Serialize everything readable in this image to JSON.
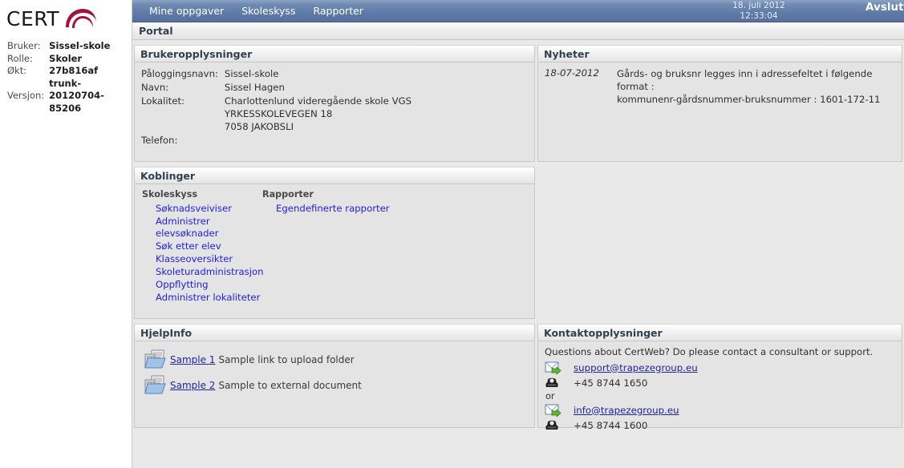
{
  "sidebar": {
    "logo_text": "CERT",
    "logo_mark_color": "#A3123A",
    "fields": [
      {
        "label": "Bruker:",
        "value": "Sissel-skole"
      },
      {
        "label": "Rolle:",
        "value": "Skoler"
      },
      {
        "label": "Økt:",
        "value": "27b816af"
      },
      {
        "label": "Versjon:",
        "value": "trunk-20120704-85206"
      }
    ],
    "version_lines": [
      "trunk-",
      "20120704-",
      "85206"
    ],
    "okt_value": "27b816af"
  },
  "navbar": {
    "items": [
      {
        "label": "Mine oppgaver",
        "name": "nav-mine-oppgaver"
      },
      {
        "label": "Skoleskyss",
        "name": "nav-skoleskyss"
      },
      {
        "label": "Rapporter",
        "name": "nav-rapporter"
      }
    ],
    "date": "18. juli 2012",
    "time": "12:33:04",
    "logout_label": "Avslutt",
    "accent": "#5e7ba8"
  },
  "portal": {
    "title": "Portal"
  },
  "panels": {
    "brukeropplysninger": {
      "title": "Brukeropplysninger",
      "rows": [
        {
          "label": "Påloggingsnavn:",
          "value": "Sissel-skole"
        },
        {
          "label": "Navn:",
          "value": "Sissel Hagen"
        }
      ],
      "lokalitet_label": "Lokalitet:",
      "lokalitet_lines": [
        "Charlottenlund videregående skole VGS",
        "YRKESSKOLEVEGEN 18",
        "7058 JAKOBSLI"
      ],
      "telefon_label": "Telefon:",
      "telefon_value": ""
    },
    "nyheter": {
      "title": "Nyheter",
      "items": [
        {
          "date": "18-07-2012",
          "line1": "Gårds- og bruksnr legges inn i adressefeltet i følgende format :",
          "line2": "kommunenr-gårdsnummer-bruksnummer : 1601-172-11"
        }
      ]
    },
    "koblinger": {
      "title": "Koblinger",
      "columns": [
        {
          "heading": "Skoleskyss",
          "links": [
            "Søknadsveiviser",
            "Administrer elevsøknader",
            "Søk etter elev",
            "Klasseoversikter",
            "Skoleturadministrasjon",
            "Oppflytting",
            "Administrer lokaliteter"
          ]
        },
        {
          "heading": "Rapporter",
          "links": [
            "Egendefinerte rapporter"
          ]
        }
      ]
    },
    "hjelpinfo": {
      "title": "HjelpInfo",
      "items": [
        {
          "link": "Sample 1",
          "desc": "Sample link to upload folder",
          "icon": "folder-icon"
        },
        {
          "link": "Sample 2",
          "desc": "Sample to external document",
          "icon": "folder-icon"
        }
      ]
    },
    "kontaktopplysninger": {
      "title": "Kontaktopplysninger",
      "intro": "Questions about CertWeb? Do please contact a consultant or support.",
      "email1": "support@trapezegroup.eu",
      "phone1": "+45 8744 1650",
      "separator": "or",
      "email2": "info@trapezegroup.eu",
      "phone2": "+45 8744 1600"
    }
  }
}
